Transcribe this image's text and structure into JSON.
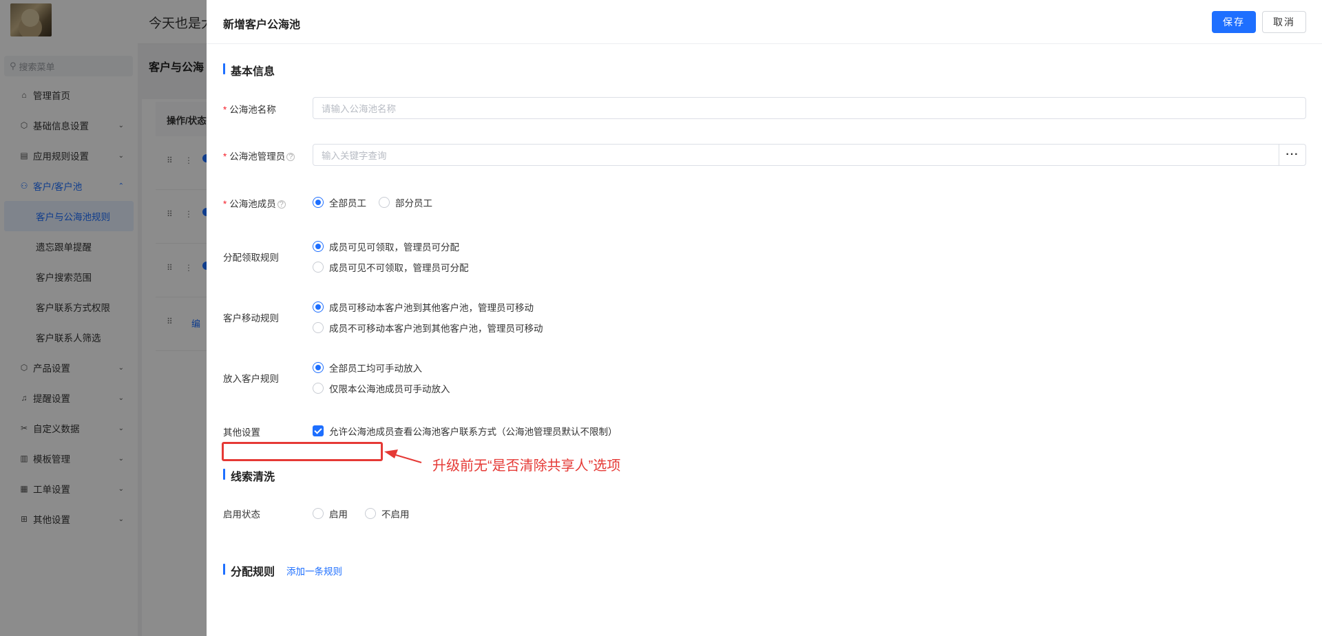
{
  "background": {
    "greeting": "今天也是大",
    "sidebar": {
      "search_placeholder": "搜索菜单",
      "items": [
        {
          "label": "管理首页",
          "icon": "home-icon",
          "glyph": "⌂"
        },
        {
          "label": "基础信息设置",
          "icon": "cube-icon",
          "glyph": "⬡",
          "chevron": "⌄"
        },
        {
          "label": "应用规则设置",
          "icon": "document-icon",
          "glyph": "▤",
          "chevron": "⌄"
        },
        {
          "label": "客户/客户池",
          "icon": "user-icon",
          "glyph": "⚇",
          "chevron": "⌃"
        },
        {
          "label": "产品设置",
          "icon": "box-icon",
          "glyph": "⬡",
          "chevron": "⌄"
        },
        {
          "label": "提醒设置",
          "icon": "bell-icon",
          "glyph": "♫",
          "chevron": "⌄"
        },
        {
          "label": "自定义数据",
          "icon": "tools-icon",
          "glyph": "✂",
          "chevron": "⌄"
        },
        {
          "label": "模板管理",
          "icon": "template-icon",
          "glyph": "▥",
          "chevron": "⌄"
        },
        {
          "label": "工单设置",
          "icon": "ticket-icon",
          "glyph": "▦",
          "chevron": "⌄"
        },
        {
          "label": "其他设置",
          "icon": "grid-icon",
          "glyph": "⊞",
          "chevron": "⌄"
        }
      ],
      "sub_items": [
        "客户与公海池规则",
        "遗忘跟单提醒",
        "客户搜索范围",
        "客户联系方式权限",
        "客户联系人筛选"
      ]
    },
    "page_title": "客户与公海",
    "table": {
      "header": "操作/状态",
      "row_handle": "⠿",
      "row_menu": "⋮",
      "edit_label": "编"
    }
  },
  "drawer": {
    "title": "新增客户公海池",
    "save_label": "保存",
    "cancel_label": "取消",
    "sections": {
      "basic": "基本信息",
      "clue": "线索清洗",
      "distribution": "分配规则"
    },
    "add_rule_label": "添加一条规则",
    "required_mark": "*",
    "help_glyph": "?",
    "fields": {
      "pool_name": {
        "label": "公海池名称",
        "placeholder": "请输入公海池名称"
      },
      "pool_admin": {
        "label": "公海池管理员",
        "placeholder": "输入关键字查询",
        "more": "···"
      },
      "pool_members": {
        "label": "公海池成员",
        "options": [
          "全部员工",
          "部分员工"
        ],
        "selected": 0
      },
      "claim_rule": {
        "label": "分配领取规则",
        "options": [
          "成员可见可领取，管理员可分配",
          "成员可见不可领取，管理员可分配"
        ],
        "selected": 0
      },
      "move_rule": {
        "label": "客户移动规则",
        "options": [
          "成员可移动本客户池到其他客户池，管理员可移动",
          "成员不可移动本客户池到其他客户池，管理员可移动"
        ],
        "selected": 0
      },
      "put_rule": {
        "label": "放入客户规则",
        "options": [
          "全部员工均可手动放入",
          "仅限本公海池成员可手动放入"
        ],
        "selected": 0
      },
      "other": {
        "label": "其他设置",
        "checkbox": "允许公海池成员查看公海池客户联系方式（公海池管理员默认不限制）",
        "checked": true
      },
      "enable_status": {
        "label": "启用状态",
        "options": [
          "启用",
          "不启用"
        ],
        "selected": null
      }
    }
  },
  "annotation": {
    "text": "升级前无“是否清除共享人”选项",
    "color": "#e53935"
  }
}
